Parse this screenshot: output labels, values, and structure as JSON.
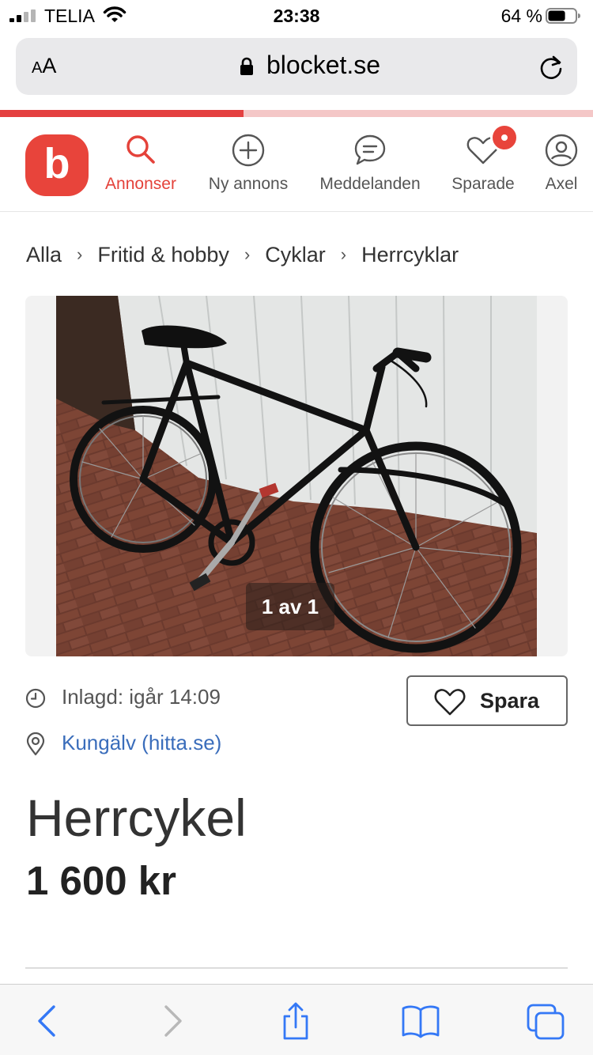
{
  "status_bar": {
    "carrier": "TELIA",
    "time": "23:38",
    "battery": "64 %",
    "battery_level": 0.64
  },
  "browser": {
    "text_size_label_small": "A",
    "text_size_label_large": "A",
    "url": "blocket.se",
    "load_progress": 0.41
  },
  "header": {
    "logo_letter": "b",
    "nav": [
      {
        "label": "Annonser",
        "icon": "search-icon",
        "active": true
      },
      {
        "label": "Ny annons",
        "icon": "plus-circle-icon"
      },
      {
        "label": "Meddelanden",
        "icon": "chat-bubble-icon"
      },
      {
        "label": "Sparade",
        "icon": "heart-icon"
      },
      {
        "label": "Axel",
        "icon": "user-icon"
      }
    ]
  },
  "breadcrumb": [
    "Alla",
    "Fritid & hobby",
    "Cyklar",
    "Herrcyklar"
  ],
  "gallery": {
    "counter": "1 av 1"
  },
  "listing": {
    "posted": "Inlagd: igår 14:09",
    "location": "Kungälv (hitta.se)",
    "title": "Herrcykel",
    "price": "1 600 kr",
    "save_label": "Spara"
  },
  "colors": {
    "brand": "#e8443b",
    "link": "#3a6dbb",
    "ios_blue": "#3478f6"
  }
}
